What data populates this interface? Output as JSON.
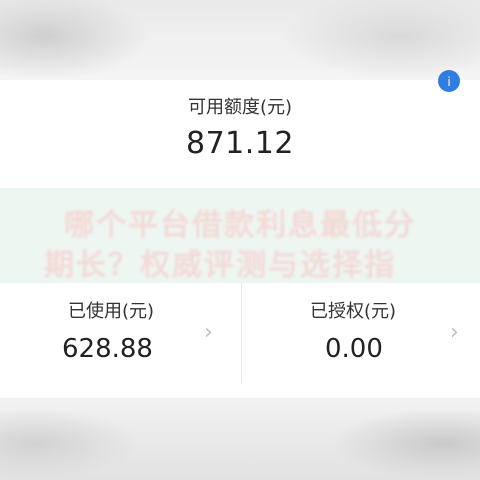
{
  "credit": {
    "available_label": "可用额度(元)",
    "available_value": "871.12",
    "used_label": "已使用(元)",
    "used_value": "628.88",
    "authorized_label": "已授权(元)",
    "authorized_value": "0.00"
  },
  "watermark": {
    "line1": "哪个平台借款利息最低分",
    "line2": "期长？权威评测与选择指"
  },
  "icons": {
    "corner": "info-icon",
    "chevron": "chevron-right-icon"
  },
  "colors": {
    "accent": "#2f7de1",
    "watermark_text": "#f3d9d6",
    "watermark_bg": "#eef6f2"
  }
}
